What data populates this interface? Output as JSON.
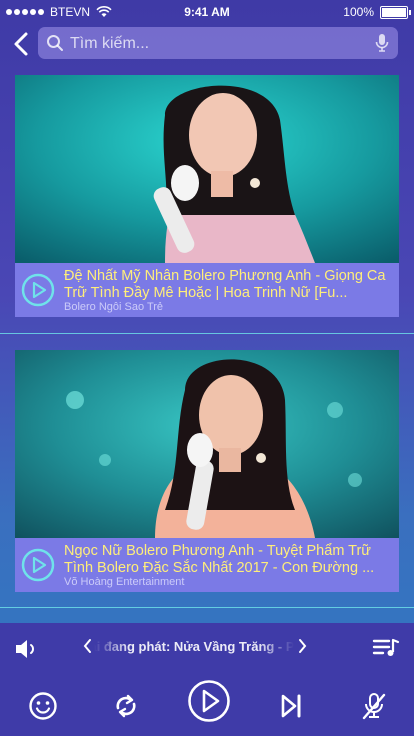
{
  "status_bar": {
    "carrier": "BTEVN",
    "time": "9:41 AM",
    "battery": "100%"
  },
  "search": {
    "placeholder": "Tìm kiếm...",
    "value": ""
  },
  "videos": [
    {
      "title": "Đệ Nhất Mỹ Nhân Bolero Phương Anh - Giọng Ca Trữ Tình Đầy Mê Hoặc | Hoa Trinh Nữ [Fu...",
      "channel": "Bolero Ngôi Sao Trẻ"
    },
    {
      "title": "Ngọc Nữ Bolero Phương Anh - Tuyệt Phẩm Trữ Tình Bolero Đặc Sắc Nhất 2017 - Con Đường ...",
      "channel": "Võ Hoàng Entertainment"
    }
  ],
  "player": {
    "now_playing": "Bài đang phát: Nửa Vầng Trăng - Phương Anh"
  },
  "colors": {
    "background": "#4a47b5",
    "card_info": "#7b7ae6",
    "title_text": "#ffee7a",
    "accent": "#6fe3ea",
    "player_bar": "#3f3ba8"
  },
  "icons": [
    "back-arrow-icon",
    "search-icon",
    "microphone-icon",
    "play-circle-icon",
    "volume-icon",
    "chevron-left-icon",
    "chevron-right-icon",
    "playlist-icon",
    "smile-icon",
    "repeat-icon",
    "play-icon",
    "skip-next-icon",
    "mic-off-icon"
  ]
}
